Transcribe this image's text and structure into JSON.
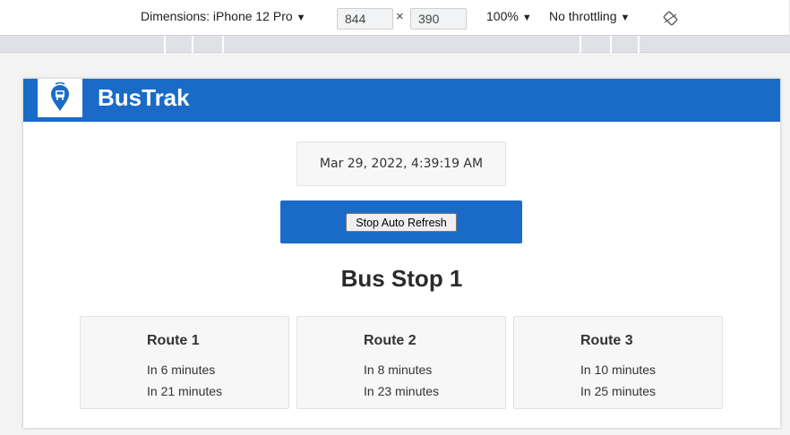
{
  "devtools": {
    "dimensions_label": "Dimensions: iPhone 12 Pro",
    "width_value": "844",
    "height_value": "390",
    "times_symbol": "×",
    "zoom_label": "100%",
    "throttling_label": "No throttling",
    "caret": "▼",
    "icons": [
      "chevron-down-icon",
      "rotate-icon"
    ]
  },
  "app": {
    "title": "BusTrak",
    "logo_icon": "bus-location-icon",
    "brand_color": "#1a6bc8",
    "datetime": "Mar 29, 2022, 4:39:19 AM",
    "refresh_button_label": "Stop Auto Refresh",
    "stop_title": "Bus Stop 1",
    "routes": [
      {
        "name": "Route 1",
        "arrivals": [
          "In 6 minutes",
          "In 21 minutes"
        ]
      },
      {
        "name": "Route 2",
        "arrivals": [
          "In 8 minutes",
          "In 23 minutes"
        ]
      },
      {
        "name": "Route 3",
        "arrivals": [
          "In 10 minutes",
          "In 25 minutes"
        ]
      }
    ]
  }
}
